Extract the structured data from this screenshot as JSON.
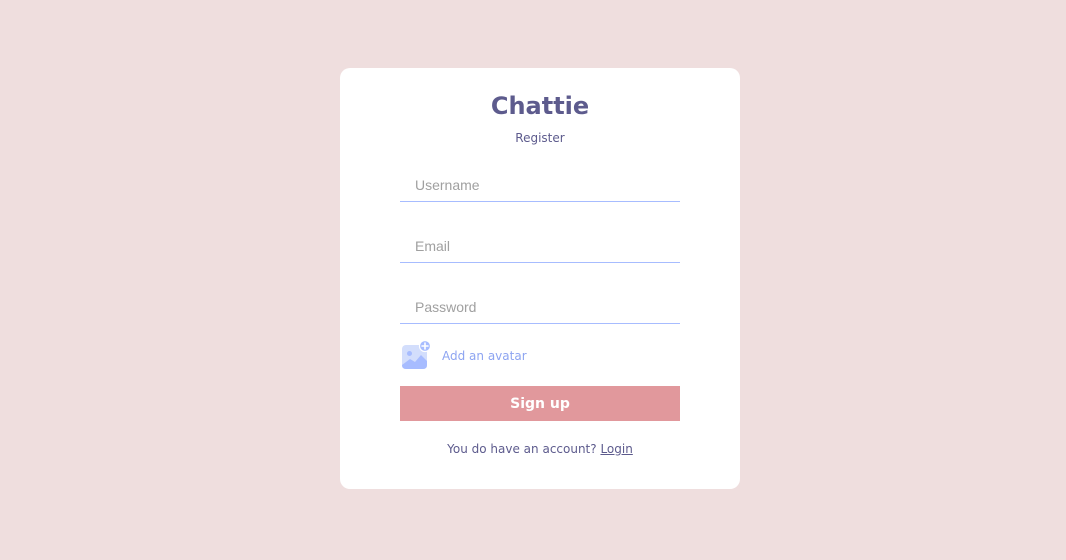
{
  "app": {
    "logo": "Chattie",
    "subtitle": "Register"
  },
  "form": {
    "username_placeholder": "Username",
    "email_placeholder": "Email",
    "password_placeholder": "Password",
    "avatar_label": "Add an avatar",
    "avatar_icon": "add-image-icon",
    "submit_label": "Sign up"
  },
  "footer": {
    "prompt": "You do have an account? ",
    "link_label": "Login"
  },
  "colors": {
    "background": "#efdede",
    "card": "#ffffff",
    "brand": "#5d5b8d",
    "accent": "#a7bcff",
    "button": "#e1989c"
  }
}
